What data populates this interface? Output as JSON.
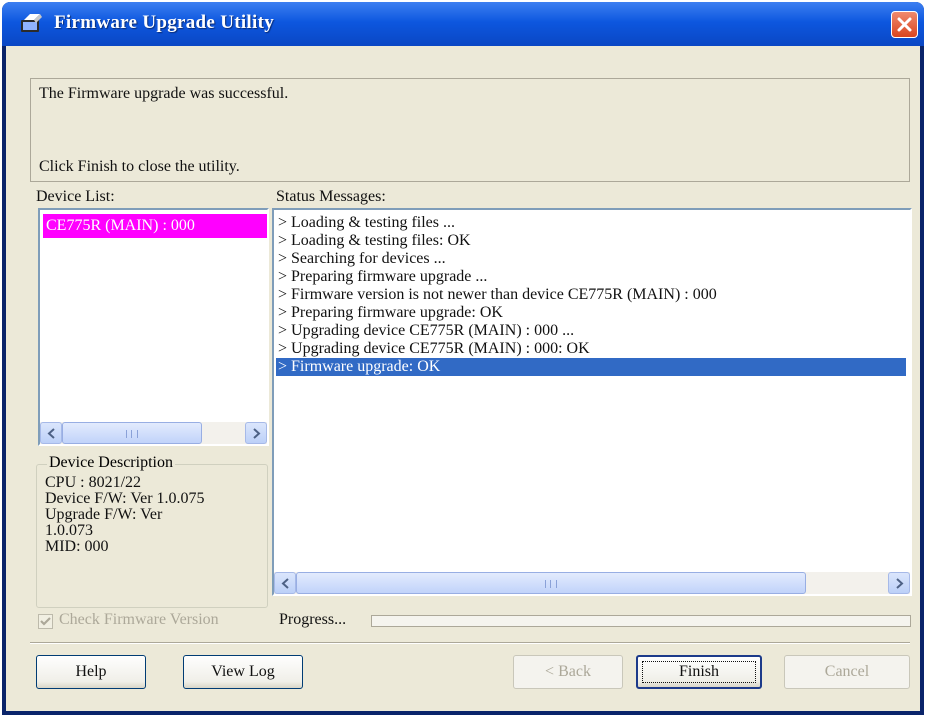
{
  "window": {
    "title": "Firmware Upgrade Utility",
    "icon": "firmware-app-icon",
    "close_icon": "close-icon"
  },
  "message": {
    "line1": "The Firmware upgrade was successful.",
    "line2": "Click Finish to close the utility."
  },
  "device_list": {
    "label": "Device List:",
    "items": [
      "CE775R (MAIN) : 000"
    ],
    "selected_index": 0,
    "highlight_color": "#ff00ff"
  },
  "device_description": {
    "title": "Device Description",
    "cpu": "CPU : 8021/22",
    "device_fw": "Device F/W: Ver 1.0.075",
    "upgrade_fw_1": "Upgrade F/W: Ver",
    "upgrade_fw_2": "1.0.073",
    "mid": "MID: 000"
  },
  "status": {
    "label": "Status Messages:",
    "messages": [
      "> Loading & testing files ...",
      "> Loading & testing files: OK",
      "> Searching for devices ...",
      "> Preparing firmware upgrade ...",
      "> Firmware version is not newer than device CE775R (MAIN) : 000",
      "> Preparing firmware upgrade: OK",
      "> Upgrading device CE775R (MAIN) : 000 ...",
      "> Upgrading device CE775R (MAIN) : 000: OK",
      "> Firmware upgrade: OK"
    ],
    "selected_index": 8,
    "selection_color": "#316ac5"
  },
  "options": {
    "check_firmware_label": "Check Firmware Version",
    "check_firmware_checked": true,
    "check_firmware_enabled": false
  },
  "progress": {
    "label": "Progress...",
    "value": 0
  },
  "buttons": {
    "help": "Help",
    "view_log": "View Log",
    "back": "< Back",
    "finish": "Finish",
    "cancel": "Cancel"
  },
  "colors": {
    "titlebar": "#0d57df",
    "close_button": "#d9451f",
    "dialog_background": "#ece9d8"
  }
}
